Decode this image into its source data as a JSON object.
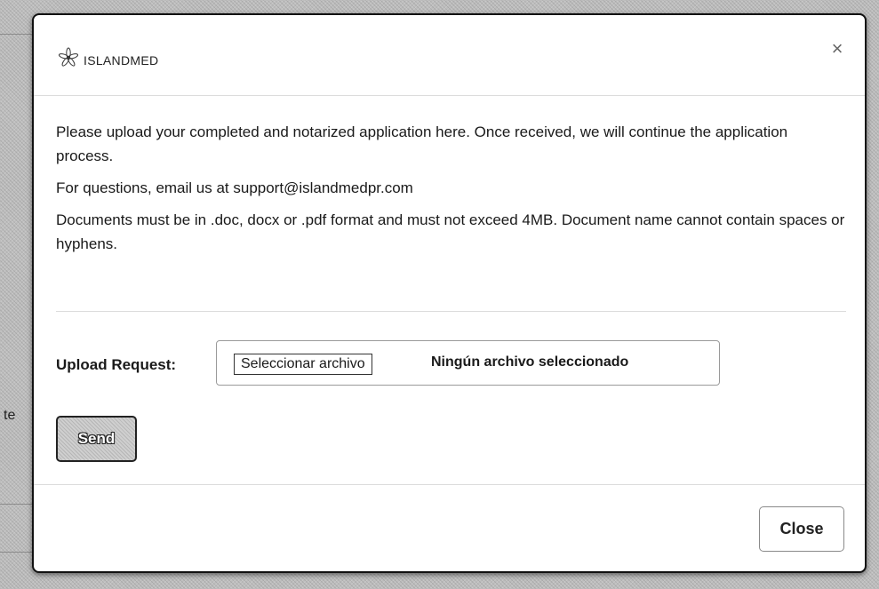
{
  "background": {
    "partial_text": "te"
  },
  "modal": {
    "logo": {
      "icon": "flower-icon",
      "text": "ISLANDMED"
    },
    "close_icon": "×",
    "body": {
      "paragraphs": [
        "Please upload your completed and notarized application here. Once received, we will continue the application process.",
        "For questions, email us at support@islandmedpr.com",
        "Documents must be in .doc, docx or .pdf format and must not exceed 4MB. Document name cannot contain spaces or hyphens."
      ]
    },
    "upload": {
      "label": "Upload Request:",
      "choose_button": "Seleccionar archivo",
      "status": "Ningún archivo seleccionado"
    },
    "send_label": "Send",
    "close_label": "Close"
  },
  "colors": {
    "overlay": "#bdbdbd",
    "modal_bg": "#ffffff",
    "send_button_bg": "#cfcfcf"
  }
}
